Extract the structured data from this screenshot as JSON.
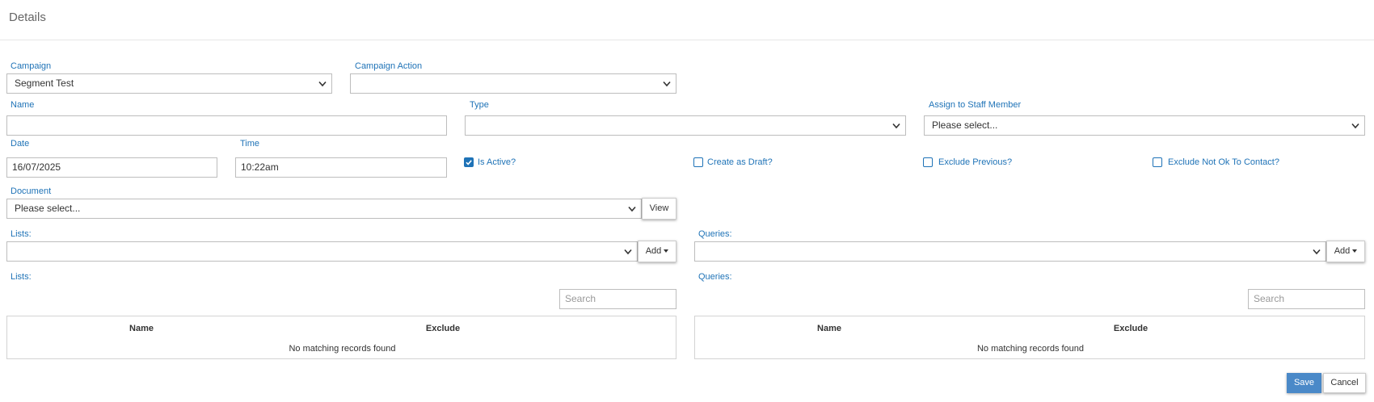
{
  "header": {
    "title": "Details"
  },
  "campaign": {
    "label": "Campaign",
    "value": "Segment Test"
  },
  "campaign_action": {
    "label": "Campaign Action",
    "value": ""
  },
  "name": {
    "label": "Name",
    "value": ""
  },
  "type": {
    "label": "Type",
    "value": ""
  },
  "staff": {
    "label": "Assign to Staff Member",
    "value": "Please select..."
  },
  "date": {
    "label": "Date",
    "value": "16/07/2025"
  },
  "time": {
    "label": "Time",
    "value": "10:22am"
  },
  "checkboxes": {
    "is_active": {
      "label": "Is Active?",
      "checked": true
    },
    "create_draft": {
      "label": "Create as Draft?",
      "checked": false
    },
    "exclude_previous": {
      "label": "Exclude Previous?",
      "checked": false
    },
    "exclude_not_ok": {
      "label": "Exclude Not Ok To Contact?",
      "checked": false
    }
  },
  "document": {
    "label": "Document",
    "value": "Please select...",
    "view_button": "View"
  },
  "lists_select": {
    "label": "Lists:",
    "value": "",
    "add_button": "Add"
  },
  "queries_select": {
    "label": "Queries:",
    "value": "",
    "add_button": "Add"
  },
  "lists_table": {
    "label": "Lists:",
    "search_placeholder": "Search",
    "columns": [
      "Name",
      "Exclude"
    ],
    "empty_text": "No matching records found"
  },
  "queries_table": {
    "label": "Queries:",
    "search_placeholder": "Search",
    "columns": [
      "Name",
      "Exclude"
    ],
    "empty_text": "No matching records found"
  },
  "footer": {
    "save_label": "Save",
    "cancel_label": "Cancel"
  },
  "colors": {
    "accent": "#1f73b7",
    "save_bg": "#4a89c8"
  }
}
